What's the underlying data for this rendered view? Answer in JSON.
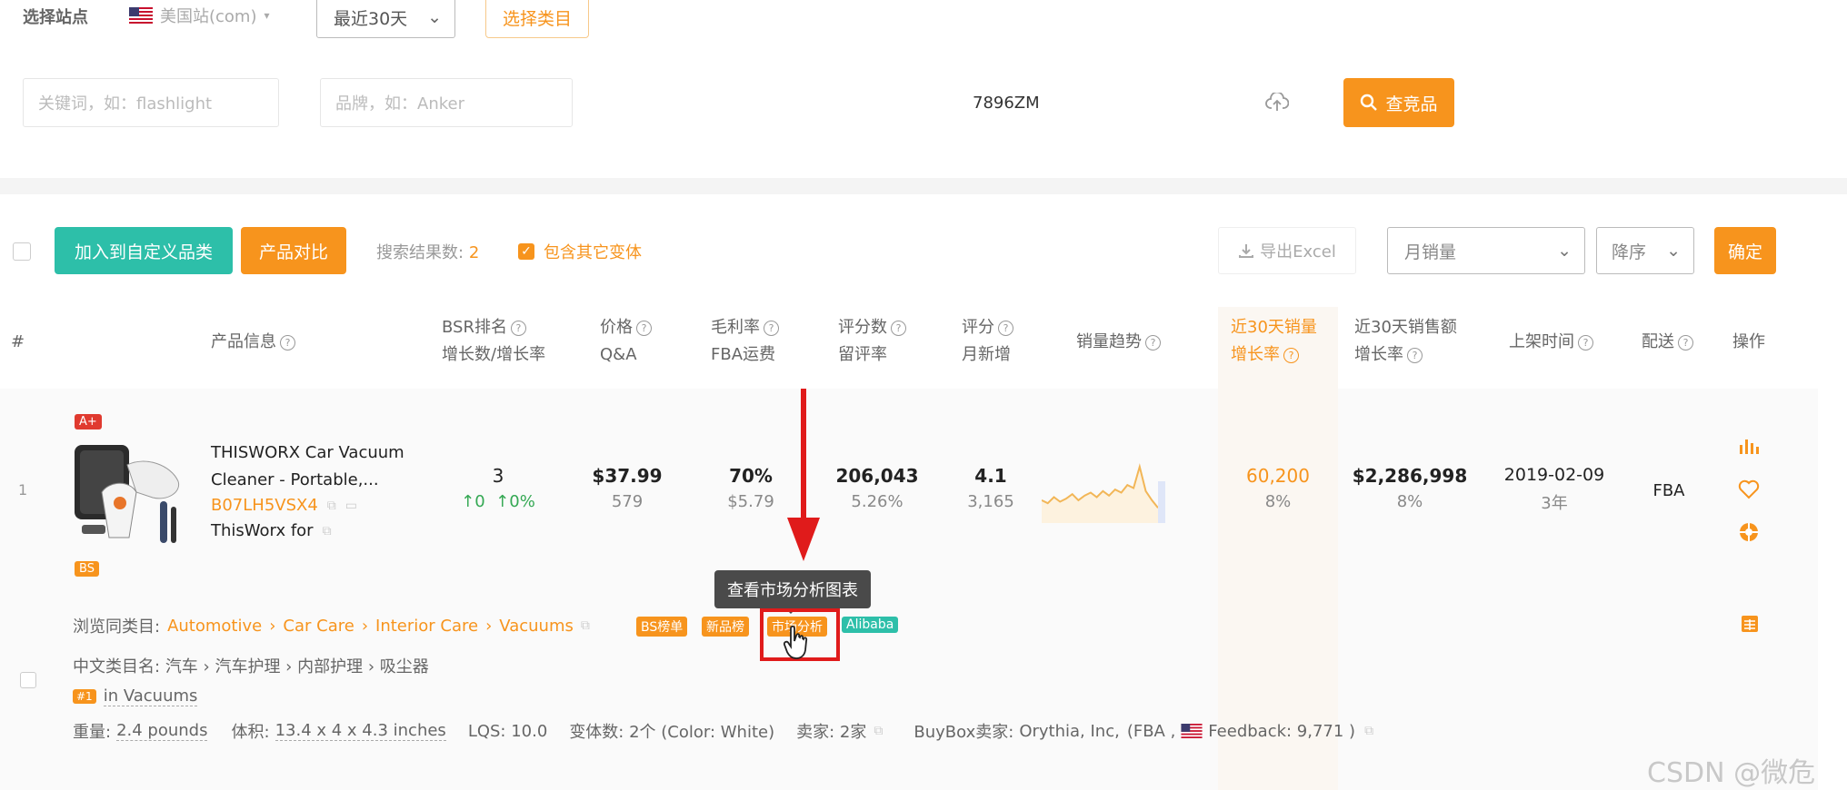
{
  "filters": {
    "site_label": "选择站点",
    "site_value": "美国站(com)",
    "period_value": "最近30天",
    "choose_category": "选择类目",
    "keyword_placeholder": "关键词，如：flashlight",
    "brand_placeholder": "品牌，如：Anker",
    "asin_value": "7896ZM",
    "search_button": "查竞品"
  },
  "toolbar": {
    "add_to_category": "加入到自定义品类",
    "compare": "产品对比",
    "result_label": "搜索结果数:",
    "result_count": "2",
    "include_variants": "包含其它变体",
    "export": "导出Excel",
    "sort_field": "月销量",
    "sort_order": "降序",
    "confirm": "确定"
  },
  "columns": {
    "index": "#",
    "product_info": "产品信息",
    "bsr_1": "BSR排名",
    "bsr_2": "增长数/增长率",
    "price_1": "价格",
    "price_2": "Q&A",
    "margin_1": "毛利率",
    "margin_2": "FBA运费",
    "reviews_1": "评分数",
    "reviews_2": "留评率",
    "rating_1": "评分",
    "rating_2": "月新增",
    "trend": "销量趋势",
    "sales30_1": "近30天销量",
    "sales30_2": "增长率",
    "revenue30_1": "近30天销售额",
    "revenue30_2": "增长率",
    "listed": "上架时间",
    "fulfillment": "配送",
    "actions": "操作"
  },
  "product": {
    "index": "1",
    "badge_top": "A+",
    "badge_bottom": "BS",
    "title_line1": "THISWORX Car Vacuum",
    "title_line2": "Cleaner - Portable,...",
    "asin": "B07LH5VSX4",
    "brand": "ThisWorx for",
    "bsr": "3",
    "bsr_change_count": "↑0",
    "bsr_change_rate": "↑0%",
    "price": "$37.99",
    "qa": "579",
    "margin": "70%",
    "fba_fee": "$5.79",
    "reviews": "206,043",
    "review_rate": "5.26%",
    "rating": "4.1",
    "monthly_new": "3,165",
    "sales30": "60,200",
    "sales30_growth": "8%",
    "revenue30": "$2,286,998",
    "revenue30_growth": "8%",
    "listed_date": "2019-02-09",
    "listed_age": "3年",
    "fulfillment": "FBA",
    "trend_values": [
      30,
      28,
      32,
      29,
      31,
      34,
      30,
      33,
      35,
      32,
      36,
      33,
      37,
      35,
      40,
      38,
      52,
      36,
      30,
      25
    ]
  },
  "details": {
    "browse_label": "浏览同类目:",
    "crumbs": [
      "Automotive",
      "Car Care",
      "Interior Care",
      "Vacuums"
    ],
    "tag_bs": "BS榜单",
    "tag_new": "新品榜",
    "tag_market": "市场分析",
    "tag_alibaba": "Alibaba",
    "cn_category_label": "中文类目名:",
    "cn_category": "汽车 › 汽车护理 › 内部护理 › 吸尘器",
    "rank_badge": "#1",
    "rank_text": "in Vacuums",
    "weight_label": "重量:",
    "weight": "2.4 pounds",
    "volume_label": "体积:",
    "volume": "13.4 x 4 x 4.3 inches",
    "lqs": "LQS: 10.0",
    "variants": "变体数: 2个 (Color: White)",
    "sellers": "卖家: 2家",
    "buybox_label": "BuyBox卖家:",
    "buybox_seller": "Orythia, Inc,",
    "buybox_fba": "(FBA ,",
    "buybox_feedback": "Feedback: 9,771 )"
  },
  "tooltip": "查看市场分析图表",
  "watermark": "CSDN @微危",
  "colors": {
    "accent_orange": "#f7941d",
    "teal": "#2dbfa9",
    "annotation_red": "#e01b1b",
    "green_up": "#34a853"
  }
}
